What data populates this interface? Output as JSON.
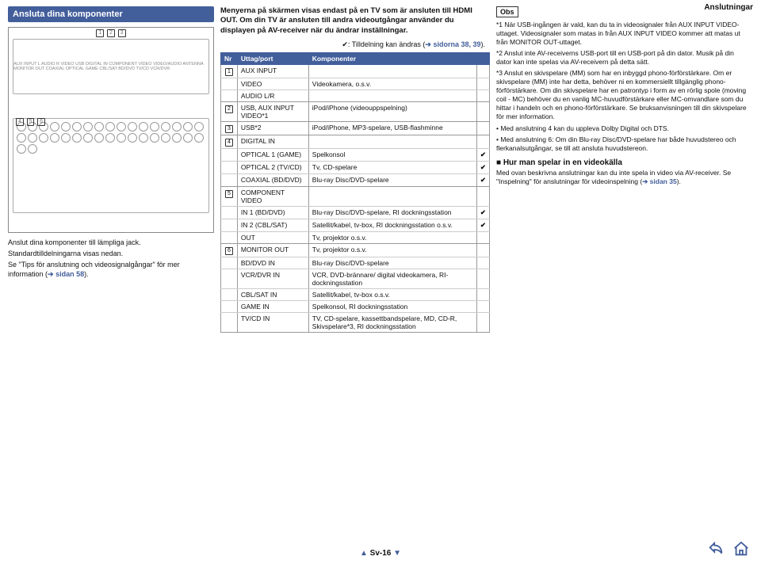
{
  "pageHeader": "Anslutningar",
  "titleBar": "Ansluta dina komponenter",
  "diagram": {
    "topTags": [
      "1",
      "2",
      "3"
    ],
    "bottomTags": [
      "4",
      "5",
      "6"
    ],
    "tinyLabels": "AUX INPUT  L AUDIO R  VIDEO  USB  DIGITAL IN  COMPONENT VIDEO  VIDEO/AUDIO  ANTENNA  MONITOR OUT  COAXIAL  OPTICAL  GAME  CBL/SAT  BD/DVD  TV/CD  VCR/DVR"
  },
  "leftText": {
    "l1": "Anslut dina komponenter till lämpliga jack.",
    "l2": "Standardtilldelningarna visas nedan.",
    "l3a": "Se \"Tips för anslutning och videosignalgångar\" för mer information (",
    "l3link": "➔ sidan 58",
    "l3b": ")."
  },
  "mid": {
    "head": "Menyerna på skärmen visas endast på en TV som är ansluten till HDMI OUT. Om din TV är ansluten till andra videoutgångar använder du displayen på AV-receiver när du ändrar inställningar.",
    "tickNoteA": "✔: Tilldelning kan ändras (",
    "tickNoteLink": "➔ sidorna 38, 39",
    "tickNoteB": ")."
  },
  "table": {
    "h1": "Nr",
    "h2": "Uttag/port",
    "h3": "Komponenter",
    "rows": [
      {
        "nr": "1",
        "port": "AUX INPUT",
        "comp": "",
        "tick": "",
        "ge": false
      },
      {
        "nr": "",
        "port": "VIDEO",
        "comp": "Videokamera, o.s.v.",
        "tick": "",
        "ge": false
      },
      {
        "nr": "",
        "port": "AUDIO L/R",
        "comp": "",
        "tick": "",
        "ge": true
      },
      {
        "nr": "2",
        "port": "USB, AUX INPUT VIDEO*1",
        "comp": "iPod/iPhone (videouppspelning)",
        "tick": "",
        "ge": true
      },
      {
        "nr": "3",
        "port": "USB*2",
        "comp": "iPod/iPhone, MP3-spelare, USB-flashminne",
        "tick": "",
        "ge": true
      },
      {
        "nr": "4",
        "port": "DIGITAL IN",
        "comp": "",
        "tick": "",
        "ge": false
      },
      {
        "nr": "",
        "port": "OPTICAL 1 (GAME)",
        "comp": "Spelkonsol",
        "tick": "✔",
        "ge": false
      },
      {
        "nr": "",
        "port": "OPTICAL 2 (TV/CD)",
        "comp": "Tv, CD-spelare",
        "tick": "✔",
        "ge": false
      },
      {
        "nr": "",
        "port": "COAXIAL (BD/DVD)",
        "comp": "Blu-ray Disc/DVD-spelare",
        "tick": "✔",
        "ge": true
      },
      {
        "nr": "5",
        "port": "COMPONENT VIDEO",
        "comp": "",
        "tick": "",
        "ge": false
      },
      {
        "nr": "",
        "port": "IN 1 (BD/DVD)",
        "comp": "Blu-ray Disc/DVD-spelare, RI dockningsstation",
        "tick": "✔",
        "ge": false
      },
      {
        "nr": "",
        "port": "IN 2 (CBL/SAT)",
        "comp": "Satellit/kabel, tv-box, RI dockningsstation o.s.v.",
        "tick": "✔",
        "ge": false
      },
      {
        "nr": "",
        "port": "OUT",
        "comp": "Tv, projektor o.s.v.",
        "tick": "",
        "ge": true
      },
      {
        "nr": "6",
        "port": "MONITOR OUT",
        "comp": "Tv, projektor o.s.v.",
        "tick": "",
        "ge": false
      },
      {
        "nr": "",
        "port": "BD/DVD IN",
        "comp": "Blu-ray Disc/DVD-spelare",
        "tick": "",
        "ge": false
      },
      {
        "nr": "",
        "port": "VCR/DVR IN",
        "comp": "VCR, DVD-brännare/ digital videokamera, RI-dockningsstation",
        "tick": "",
        "ge": false
      },
      {
        "nr": "",
        "port": "CBL/SAT IN",
        "comp": "Satellit/kabel, tv-box o.s.v.",
        "tick": "",
        "ge": false
      },
      {
        "nr": "",
        "port": "GAME IN",
        "comp": "Spelkonsol, RI dockningsstation",
        "tick": "",
        "ge": false
      },
      {
        "nr": "",
        "port": "TV/CD IN",
        "comp": "TV, CD-spelare, kassettbandspelare, MD, CD-R, Skivspelare*3, RI dockningsstation",
        "tick": "",
        "ge": true
      }
    ]
  },
  "right": {
    "obs": "Obs",
    "n1": "*1 När USB-ingången är vald, kan du ta in videosignaler från AUX INPUT VIDEO-uttaget. Videosignaler som matas in från AUX INPUT VIDEO kommer att matas ut från MONITOR OUT-uttaget.",
    "n2": "*2 Anslut inte AV-receiverns USB-port till en USB-port på din dator. Musik på din dator kan inte spelas via AV-receivern på detta sätt.",
    "n3": "*3 Anslut en skivspelare (MM) som har en inbyggd phono-förförstärkare. Om er skivspelare (MM) inte har detta, behöver ni en kommersiellt tillgänglig phono-förförstärkare. Om din skivspelare har en patrontyp i form av en rörlig spole (moving coil - MC) behöver du en vanlig MC-huvudförstärkare eller MC-omvandlare som du hittar i handeln och en phono-förförstärkare. Se bruksanvisningen till din skivspelare för mer information.",
    "b1": "Med anslutning 4 kan du uppleva Dolby Digital och DTS.",
    "b2": "Med anslutning 6: Om din Blu-ray Disc/DVD-spelare har både huvudstereo och flerkanalsutgångar, se till att ansluta huvudstereon.",
    "secHead": "Hur man spelar in en videokälla",
    "secBody1": "Med ovan beskrivna anslutningar kan du inte spela in video via AV-receiver. Se \"Inspelning\" för anslutningar för videoinspelning (",
    "secLink": "➔ sidan 35",
    "secBody2": ")."
  },
  "footer": {
    "page": "Sv-16"
  }
}
